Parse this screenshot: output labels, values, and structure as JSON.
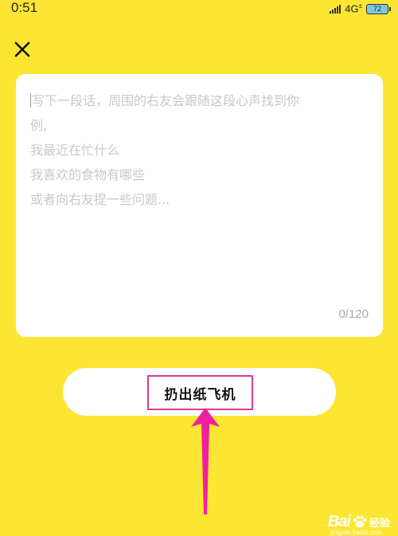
{
  "status_bar": {
    "time": "0:51",
    "network": "4G",
    "battery": "72"
  },
  "compose": {
    "placeholder_lines": [
      "写下一段话，周围的右友会跟随这段心声找到你",
      "例,",
      "我最近在忙什么",
      "我喜欢的食物有哪些",
      "或者向右友提一些问题..."
    ],
    "counter": "0/120"
  },
  "action": {
    "throw_label": "扔出纸飞机"
  },
  "watermark": {
    "brand": "Bai",
    "suffix": "经验",
    "url": "jingyan.baidu.com"
  },
  "colors": {
    "background": "#FDE633",
    "highlight": "#E2388F",
    "arrow": "#F01FA0"
  }
}
